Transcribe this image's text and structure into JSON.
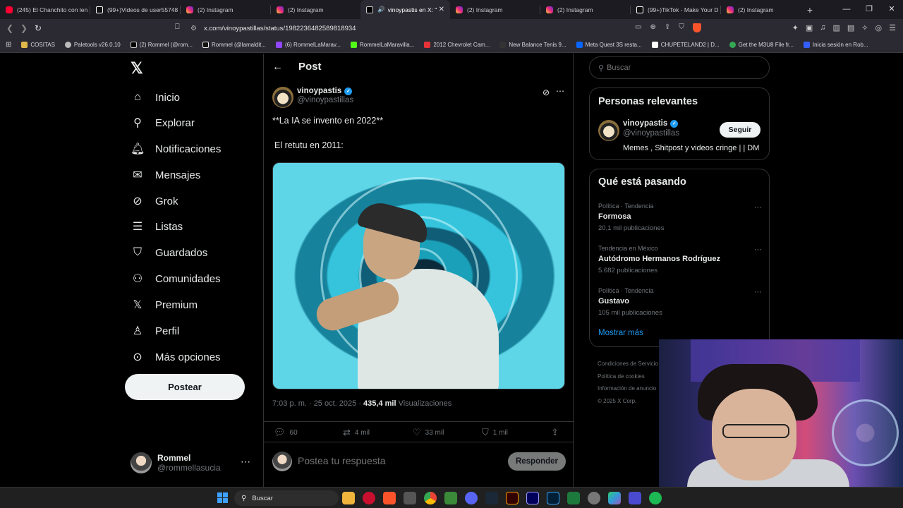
{
  "browser": {
    "tabs": [
      {
        "title": "(245) El Chanchito con len",
        "icon": "youtube-icon",
        "active": false
      },
      {
        "title": "(99+)Videos de user55748",
        "icon": "tiktok-icon",
        "active": false
      },
      {
        "title": "(2) Instagram",
        "icon": "instagram-icon",
        "active": false
      },
      {
        "title": "(2) Instagram",
        "icon": "instagram-icon",
        "active": false
      },
      {
        "title": "vinoypastis en X: \"",
        "icon": "x-icon",
        "active": true
      },
      {
        "title": "(2) Instagram",
        "icon": "instagram-icon",
        "active": false
      },
      {
        "title": "(2) Instagram",
        "icon": "instagram-icon",
        "active": false
      },
      {
        "title": "(99+)TikTok - Make Your D",
        "icon": "tiktok-icon",
        "active": false
      },
      {
        "title": "(2) Instagram",
        "icon": "instagram-icon",
        "active": false
      }
    ],
    "new_tab": "+",
    "url": "x.com/vinoypastillas/status/1982236482589818934",
    "bookmarks": [
      "COSITAS",
      "Paletools v26.0.10",
      "(2) Rommel (@rom...",
      "Rommel (@lamaldit...",
      "(6) RommelLaMarav...",
      "RommelLaMaravilla...",
      "2012 Chevrolet Cam...",
      "New Balance Tenis 9...",
      "Meta Quest 3S resta...",
      "CHUPETELAND2 | D...",
      "Get the M3U8 File fr...",
      "Inicia sesión en Rob..."
    ]
  },
  "x": {
    "nav": {
      "items": [
        {
          "label": "Inicio",
          "icon": "home-icon"
        },
        {
          "label": "Explorar",
          "icon": "search-icon"
        },
        {
          "label": "Notificaciones",
          "icon": "bell-icon"
        },
        {
          "label": "Mensajes",
          "icon": "envelope-icon"
        },
        {
          "label": "Grok",
          "icon": "grok-icon"
        },
        {
          "label": "Listas",
          "icon": "list-icon"
        },
        {
          "label": "Guardados",
          "icon": "bookmark-icon"
        },
        {
          "label": "Comunidades",
          "icon": "communities-icon"
        },
        {
          "label": "Premium",
          "icon": "x-premium-icon"
        },
        {
          "label": "Perfil",
          "icon": "person-icon"
        },
        {
          "label": "Más opciones",
          "icon": "more-circle-icon"
        }
      ],
      "post_button": "Postear"
    },
    "account": {
      "name": "Rommel",
      "handle": "@rommellasucia"
    },
    "post": {
      "header_title": "Post",
      "author_name": "vinoypastis",
      "author_handle": "@vinoypastillas",
      "text_line_1": "**La IA se invento en 2022**",
      "text_line_2": "El retutu en 2011:",
      "time": "7:03 p. m. · 25 oct. 2025 ·",
      "views_count": "435,4 mil",
      "views_label": "Visualizaciones",
      "replies": "60",
      "reposts": "4 mil",
      "likes": "33 mil",
      "bookmarks": "1 mil",
      "reply_placeholder": "Postea tu respuesta",
      "reply_button": "Responder"
    },
    "sidebar": {
      "search_placeholder": "Buscar",
      "relevant": {
        "title": "Personas relevantes",
        "name": "vinoypastis",
        "handle": "@vinoypastillas",
        "follow": "Seguir",
        "bio": "Memes , Shitpost y videos cringe | | DM"
      },
      "trends": {
        "title": "Qué está pasando",
        "items": [
          {
            "context": "Política · Tendencia",
            "name": "Formosa",
            "count": "20,1 mil publicaciones"
          },
          {
            "context": "Tendencia en México",
            "name": "Autódromo Hermanos Rodríguez",
            "count": "5.682 publicaciones"
          },
          {
            "context": "Política · Tendencia",
            "name": "Gustavo",
            "count": "105 mil publicaciones"
          }
        ],
        "show_more": "Mostrar más"
      },
      "footer": [
        "Condiciones de Servicio",
        "Política de cookies",
        "Información de anuncio",
        "© 2025 X Corp."
      ]
    }
  },
  "taskbar": {
    "search_label": "Buscar"
  },
  "colors": {
    "accent": "#1d9bf0",
    "background": "#000000",
    "border": "#2f3336",
    "muted_text": "#71767b"
  }
}
